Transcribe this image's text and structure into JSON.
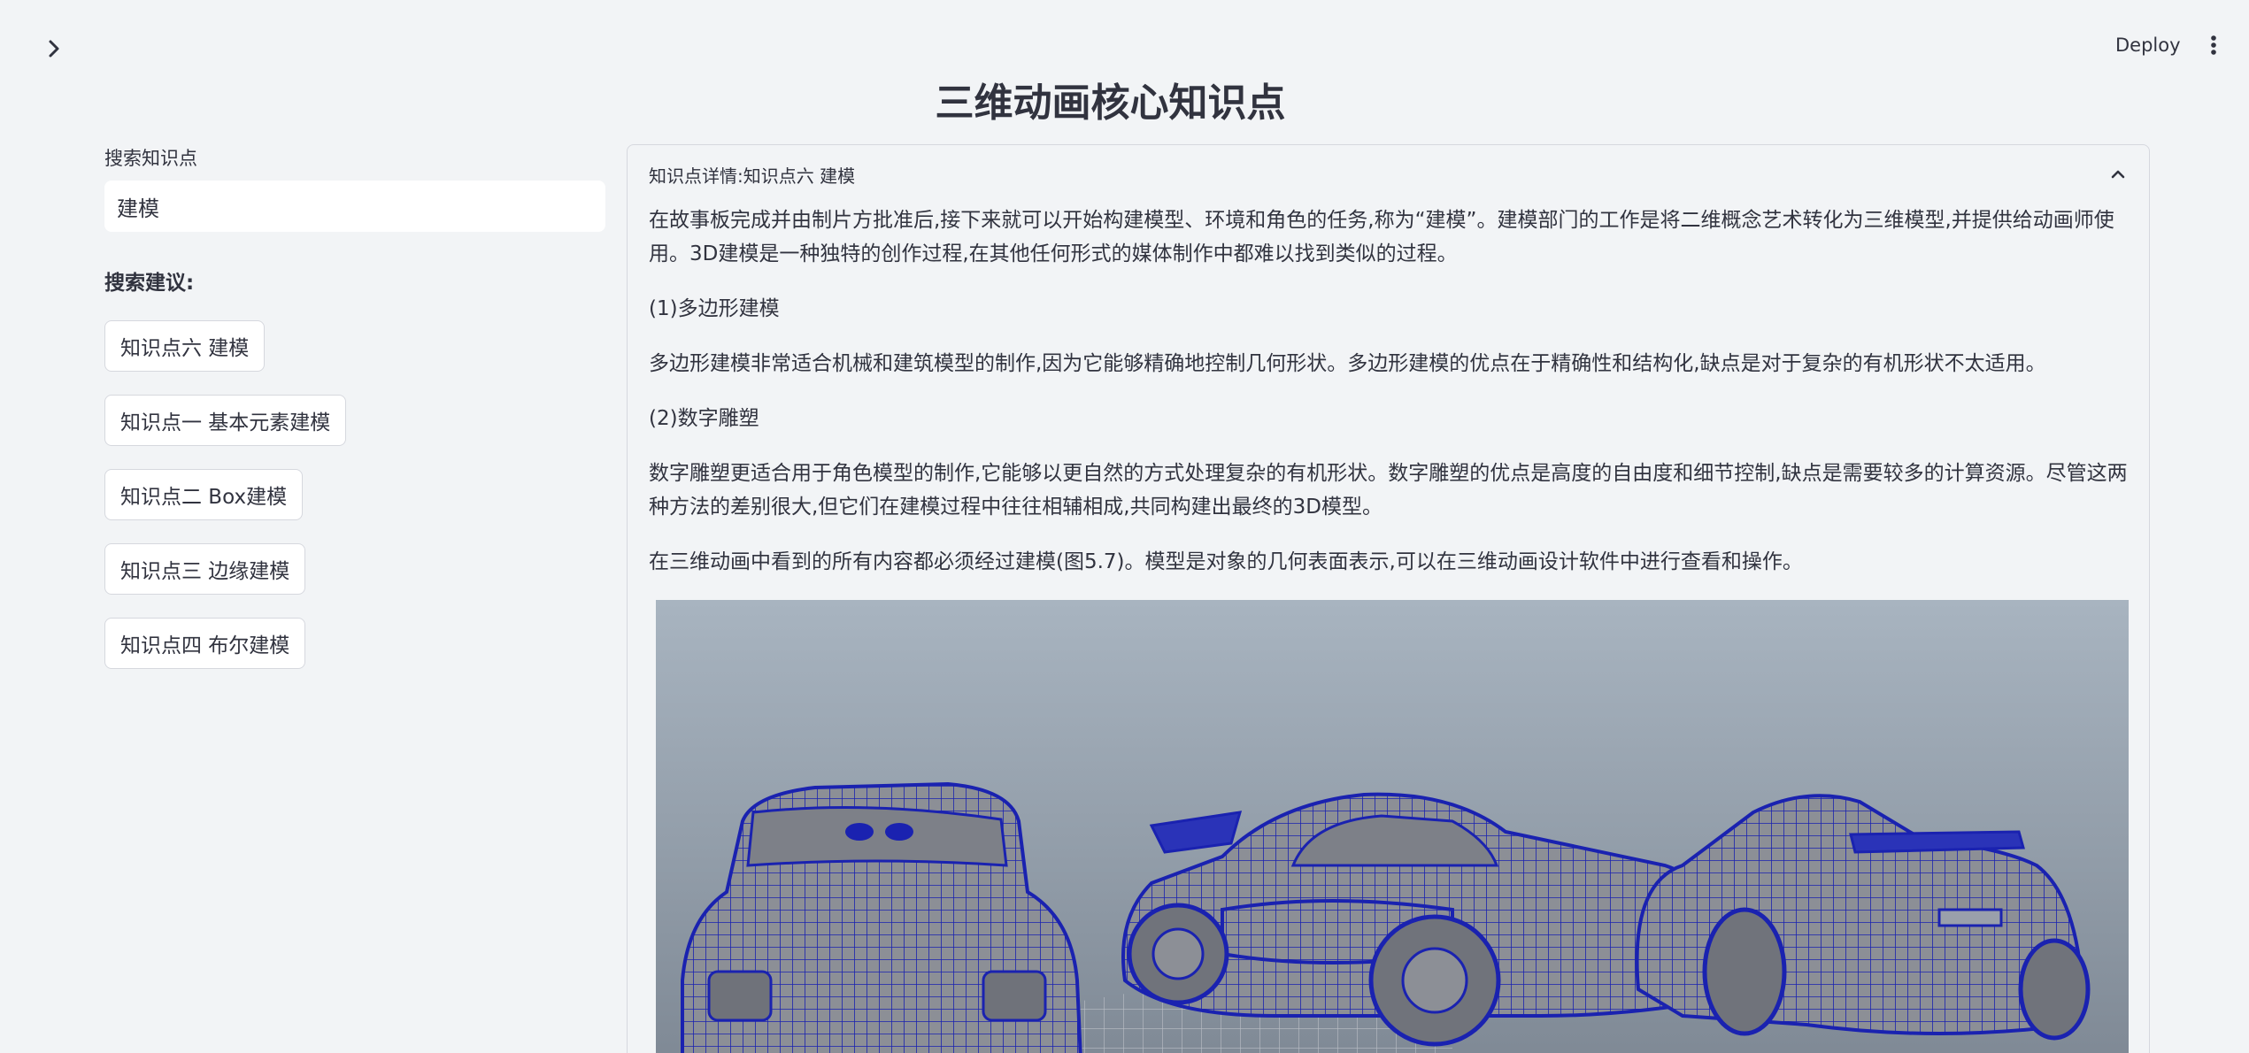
{
  "header": {
    "deploy_label": "Deploy",
    "sidebar_toggle_icon": "chevron-right-icon",
    "menu_icon": "vertical-dots-icon"
  },
  "page": {
    "title": "三维动画核心知识点"
  },
  "search": {
    "label": "搜索知识点",
    "value": "建模"
  },
  "suggestions": {
    "title": "搜索建议:",
    "items": [
      "知识点六 建模",
      "知识点一 基本元素建模",
      "知识点二 Box建模",
      "知识点三 边缘建模",
      "知识点四 布尔建模"
    ]
  },
  "detail": {
    "header": "知识点详情:知识点六 建模",
    "collapse_icon": "chevron-up-icon",
    "paragraphs": [
      "在故事板完成并由制片方批准后,接下来就可以开始构建模型、环境和角色的任务,称为“建模”。建模部门的工作是将二维概念艺术转化为三维模型,并提供给动画师使用。3D建模是一种独特的创作过程,在其他任何形式的媒体制作中都难以找到类似的过程。",
      "(1)多边形建模",
      "多边形建模非常适合机械和建筑模型的制作,因为它能够精确地控制几何形状。多边形建模的优点在于精确性和结构化,缺点是对于复杂的有机形状不太适用。",
      "(2)数字雕塑",
      "数字雕塑更适合用于角色模型的制作,它能够以更自然的方式处理复杂的有机形状。数字雕塑的优点是高度的自由度和细节控制,缺点是需要较多的计算资源。尽管这两种方法的差别很大,但它们在建模过程中往往相辅相成,共同构建出最终的3D模型。",
      "在三维动画中看到的所有内容都必须经过建模(图5.7)。模型是对象的几何表面表示,可以在三维动画设计软件中进行查看和操作。"
    ]
  },
  "colors": {
    "background": "#f2f4f6",
    "text": "#31333f",
    "wireframe": "#1a22b0"
  }
}
